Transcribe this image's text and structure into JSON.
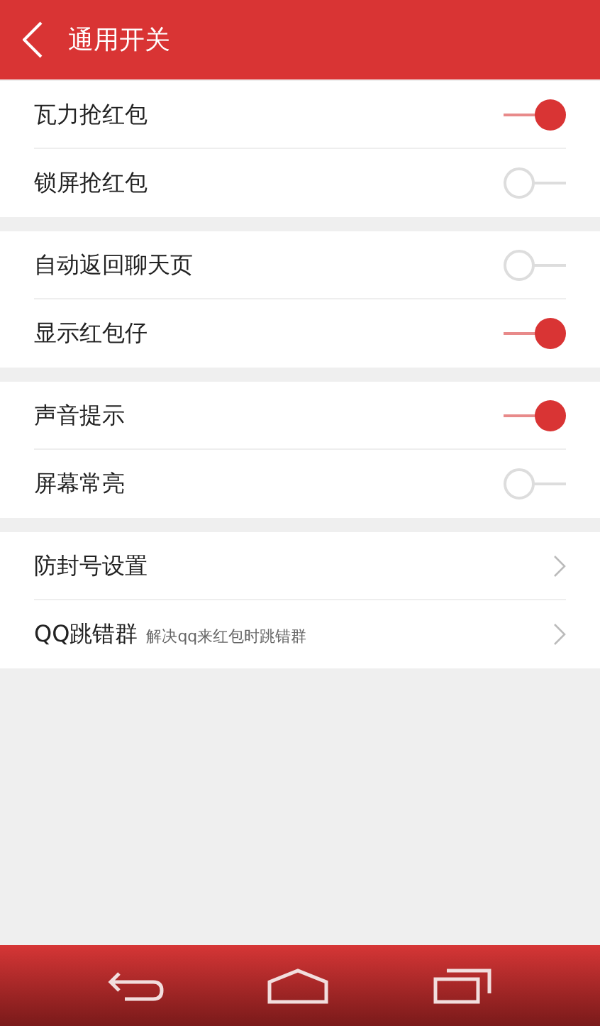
{
  "header": {
    "title": "通用开关"
  },
  "sections": [
    {
      "items": [
        {
          "kind": "toggle",
          "label": "瓦力抢红包",
          "on": true
        },
        {
          "kind": "toggle",
          "label": "锁屏抢红包",
          "on": false
        }
      ]
    },
    {
      "items": [
        {
          "kind": "toggle",
          "label": "自动返回聊天页",
          "on": false
        },
        {
          "kind": "toggle",
          "label": "显示红包仔",
          "on": true
        }
      ]
    },
    {
      "items": [
        {
          "kind": "toggle",
          "label": "声音提示",
          "on": true
        },
        {
          "kind": "toggle",
          "label": "屏幕常亮",
          "on": false
        }
      ]
    },
    {
      "items": [
        {
          "kind": "link",
          "label": "防封号设置"
        },
        {
          "kind": "link",
          "label": "QQ跳错群",
          "hint": "解决qq来红包时跳错群"
        }
      ]
    }
  ]
}
